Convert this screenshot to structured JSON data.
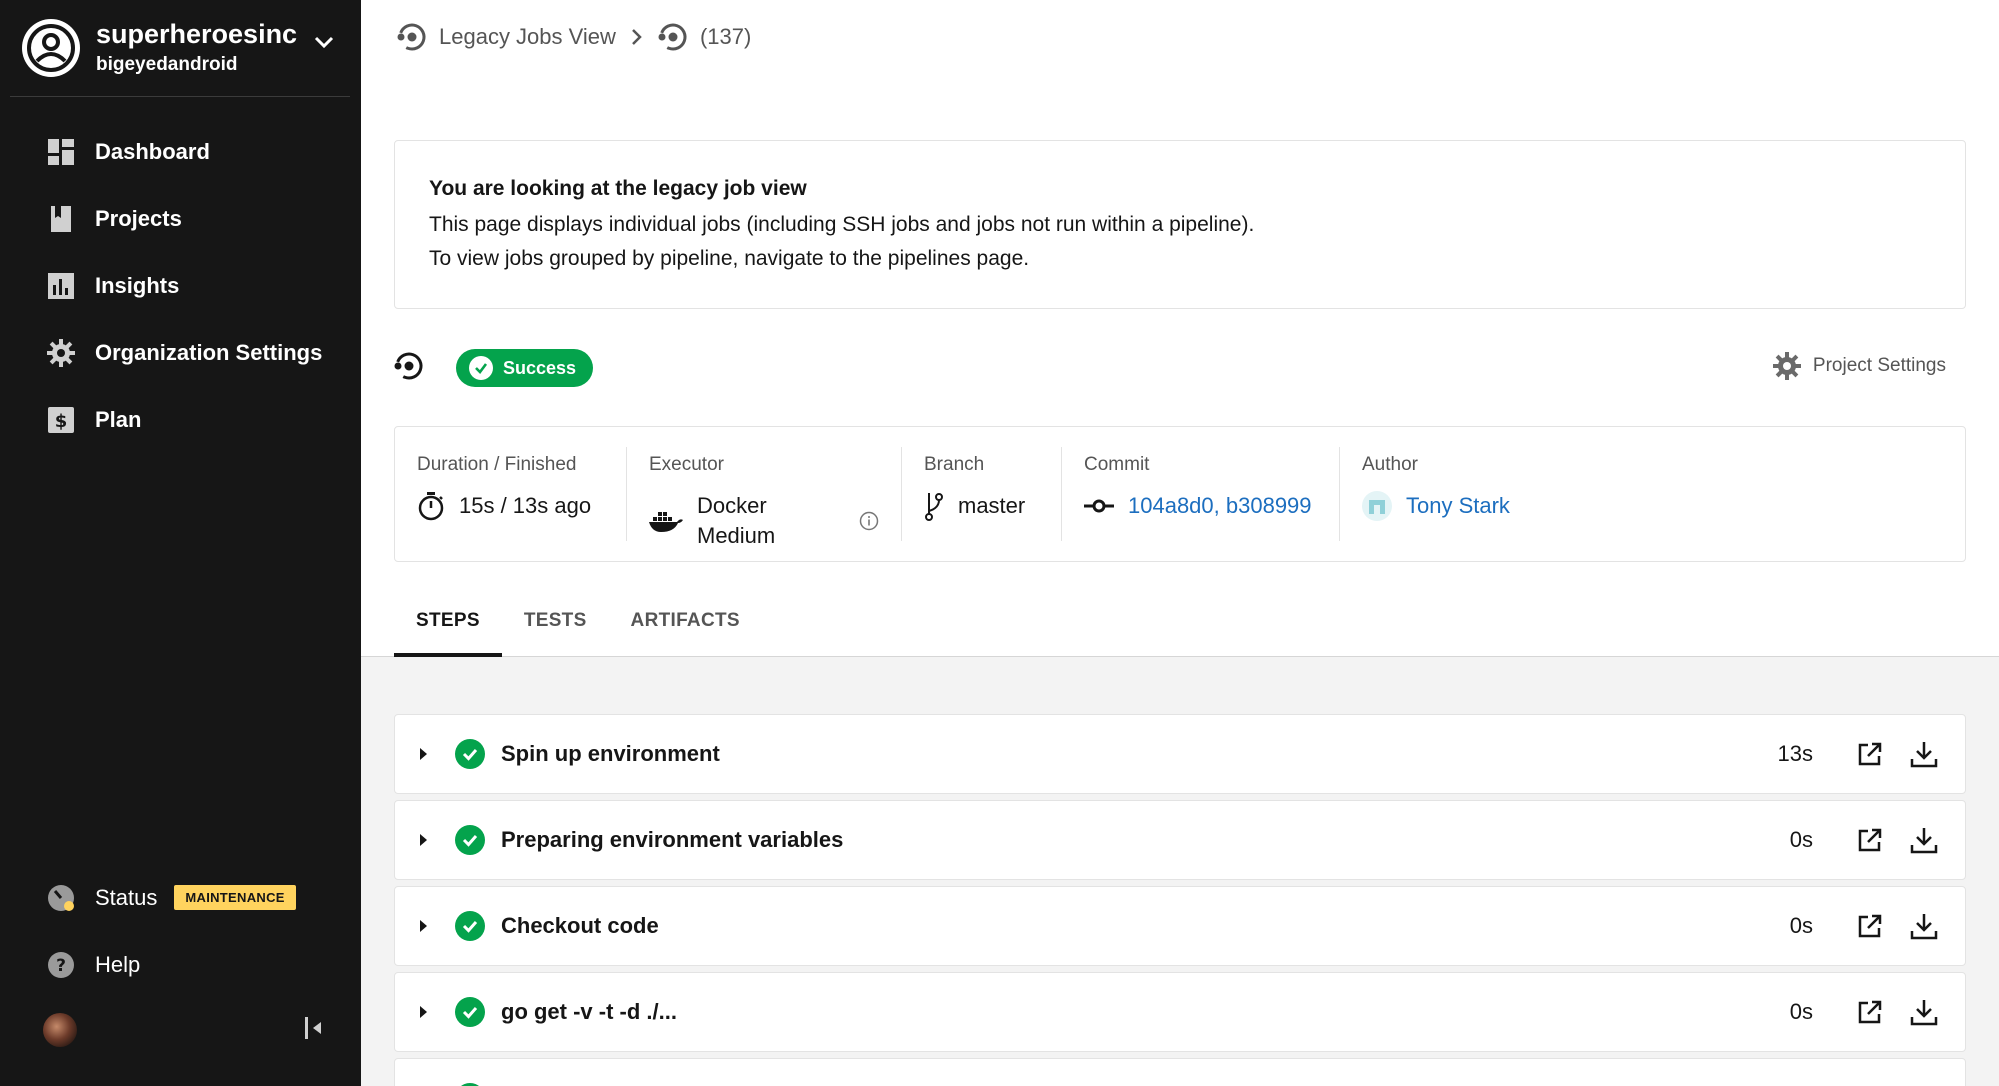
{
  "sidebar": {
    "org_name": "superheroesinc",
    "org_user": "bigeyedandroid",
    "items": [
      {
        "label": "Dashboard",
        "icon": "dashboard-icon"
      },
      {
        "label": "Projects",
        "icon": "book-icon"
      },
      {
        "label": "Insights",
        "icon": "bar-chart-icon"
      },
      {
        "label": "Organization Settings",
        "icon": "gear-icon"
      },
      {
        "label": "Plan",
        "icon": "dollar-icon"
      }
    ],
    "status_label": "Status",
    "status_badge": "MAINTENANCE",
    "help_label": "Help"
  },
  "breadcrumb": {
    "section": "Legacy Jobs View",
    "job": "(137)"
  },
  "legacy_notice": {
    "title": "You are looking at the legacy job view",
    "line1": "This page displays individual jobs (including SSH jobs and jobs not run within a pipeline).",
    "line2": "To view jobs grouped by pipeline, navigate to the pipelines page."
  },
  "job_status": {
    "label": "Success",
    "color": "#04a34c"
  },
  "project_settings_label": "Project Settings",
  "meta": {
    "duration_label": "Duration / Finished",
    "duration_value": "15s / 13s ago",
    "executor_label": "Executor",
    "executor_value": "Docker Medium",
    "branch_label": "Branch",
    "branch_value": "master",
    "commit_label": "Commit",
    "commit_value": "104a8d0, b308999",
    "author_label": "Author",
    "author_value": "Tony Stark"
  },
  "tabs": [
    "STEPS",
    "TESTS",
    "ARTIFACTS"
  ],
  "steps": [
    {
      "name": "Spin up environment",
      "duration": "13s"
    },
    {
      "name": "Preparing environment variables",
      "duration": "0s"
    },
    {
      "name": "Checkout code",
      "duration": "0s"
    },
    {
      "name": "go get -v -t -d ./...",
      "duration": "0s"
    }
  ],
  "colors": {
    "sidebar_bg": "#161616",
    "success": "#04a34c",
    "link": "#1c6ebf",
    "maintenance": "#ffd35e"
  }
}
